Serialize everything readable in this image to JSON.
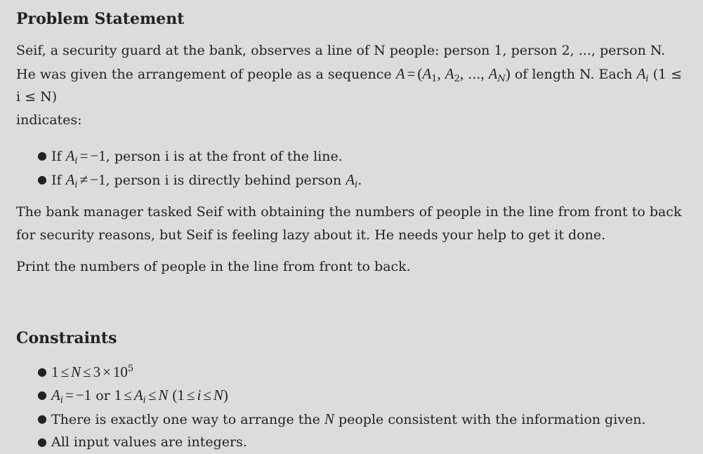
{
  "problem": {
    "heading": "Problem Statement",
    "para1": {
      "seg1": "Seif, a security guard at the bank, observes a line of N people: person 1, person 2, ..., person N. He was given the arrangement of people as a sequence ",
      "seg2": " of length N. Each ",
      "seg3": " (1 ≤ i ≤ N)",
      "seg4": "indicates:"
    },
    "bullets": [
      {
        "prefix": "If ",
        "suffix": ", person i is at the front of the line."
      },
      {
        "prefix": "If ",
        "suffix": ", person i is directly behind person ",
        "end": "."
      }
    ],
    "para2": "The bank manager tasked Seif with obtaining the numbers of people in the line from front to back for security reasons, but Seif is feeling lazy about it. He needs your help to get it done.",
    "para3": "Print the numbers of people in the line from front to back."
  },
  "constraints": {
    "heading": "Constraints",
    "items": [
      {
        "text": ""
      },
      {
        "or": " or "
      },
      {
        "prefix": "There is exactly one way to arrange the ",
        "suffix": " people consistent with the information given."
      },
      {
        "text": "All input values are integers."
      }
    ]
  },
  "math": {
    "A": "A",
    "N": "N",
    "i": "i",
    "one": "1",
    "two": "2",
    "neg1": "−1",
    "eq": "=",
    "neq": "≠",
    "le": "≤",
    "times": "×",
    "three": "3",
    "ten": "10",
    "five": "5",
    "ellipsis": "...",
    "comma": ",",
    "lparen": "(",
    "rparen": ")"
  }
}
